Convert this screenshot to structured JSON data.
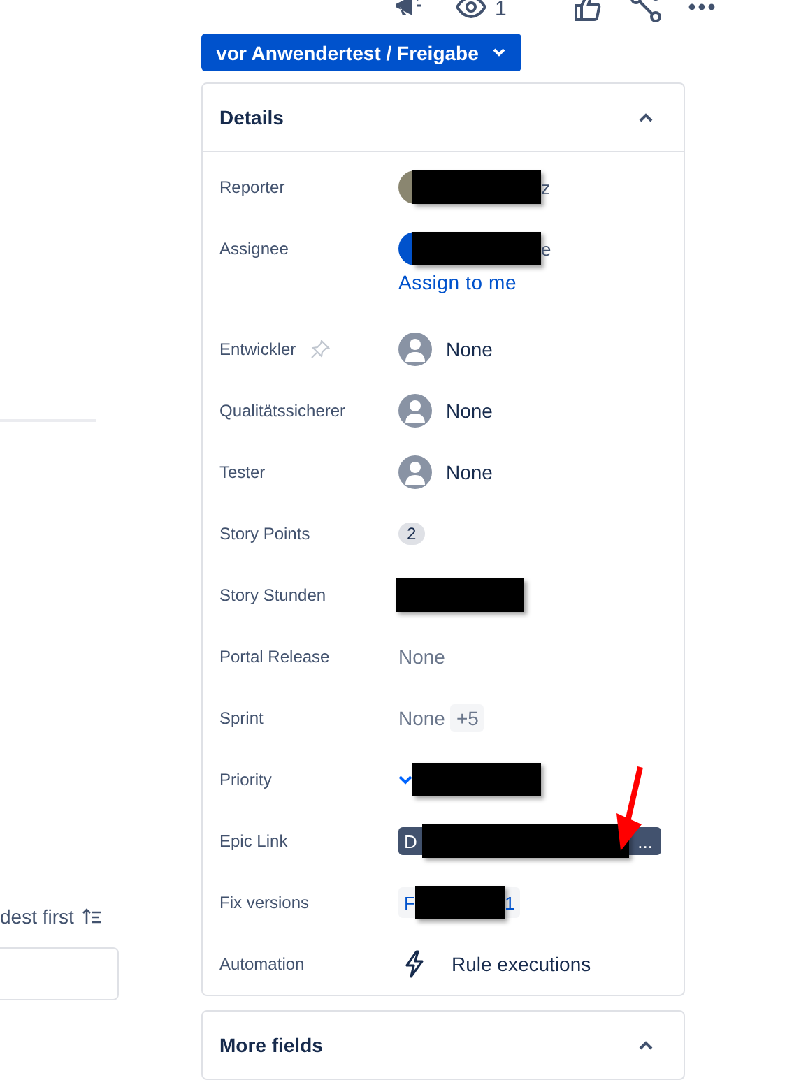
{
  "top_actions": [
    {
      "kind": "megaphone"
    },
    {
      "kind": "watch",
      "count": "1"
    },
    {
      "kind": "like"
    },
    {
      "kind": "share"
    },
    {
      "kind": "more"
    }
  ],
  "status_button": {
    "label": "vor Anwendertest / Freigabe"
  },
  "details": {
    "title": "Details",
    "expanded": true,
    "fields": [
      {
        "label": "Reporter",
        "kind": "user",
        "color": "#8a8670",
        "tail": "z",
        "pinnable": false,
        "marked": false
      },
      {
        "label": "Assignee",
        "kind": "user",
        "color": "#0052cc",
        "tail": "e",
        "link": "Assign to me",
        "pinnable": false,
        "marked": false
      },
      {
        "label": "Entwickler",
        "kind": "empty_user",
        "value": "None",
        "pinnable": true,
        "marked": false
      },
      {
        "label": "Qualitätssicherer",
        "kind": "empty_user",
        "value": "None",
        "pinnable": false,
        "marked": false
      },
      {
        "label": "Tester",
        "kind": "empty_user",
        "value": "None",
        "pinnable": false,
        "marked": false
      },
      {
        "label": "Story Points",
        "kind": "badge",
        "value": "2",
        "pinnable": false,
        "marked": false
      },
      {
        "label": "Story Stunden",
        "kind": "redacted",
        "pinnable": false,
        "marked": false
      },
      {
        "label": "Portal Release",
        "kind": "text",
        "value": "None",
        "pinnable": false,
        "marked": false
      },
      {
        "label": "Sprint",
        "kind": "text",
        "value": "None",
        "extra": "+5",
        "pinnable": false,
        "marked": false
      },
      {
        "label": "Priority",
        "kind": "priority",
        "pinnable": false,
        "marked": false
      },
      {
        "label": "Epic Link",
        "kind": "epic",
        "head": "D",
        "tail": "...",
        "pinnable": false,
        "marked": true
      },
      {
        "label": "Fix versions",
        "kind": "version",
        "head": "F",
        "tail": "1",
        "pinnable": false,
        "marked": false
      },
      {
        "label": "Automation",
        "kind": "automation",
        "value": "Rule executions",
        "pinnable": false,
        "marked": false
      }
    ]
  },
  "more_fields": {
    "title": "More fields",
    "expanded": true
  },
  "activity": {
    "sort_button": "dest first"
  }
}
